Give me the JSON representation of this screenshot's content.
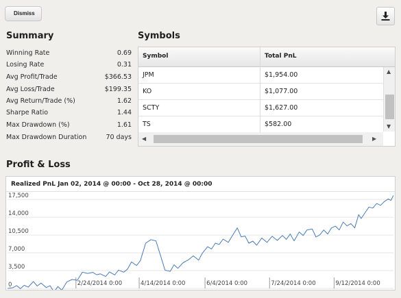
{
  "toolbar": {
    "dismiss_label": "Dismiss",
    "download_icon": "download-icon"
  },
  "summary": {
    "title": "Summary",
    "rows": [
      {
        "label": "Winning Rate",
        "value": "0.69"
      },
      {
        "label": "Losing Rate",
        "value": "0.31"
      },
      {
        "label": "Avg Profit/Trade",
        "value": "$366.53"
      },
      {
        "label": "Avg Loss/Trade",
        "value": "$199.35"
      },
      {
        "label": "Avg Return/Trade (%)",
        "value": "1.62"
      },
      {
        "label": "Sharpe Ratio",
        "value": "1.44"
      },
      {
        "label": "Max Drawdown (%)",
        "value": "1.61"
      },
      {
        "label": "Max Drawdown Duration",
        "value": "70 days"
      }
    ]
  },
  "symbols": {
    "title": "Symbols",
    "columns": [
      "Symbol",
      "Total PnL"
    ],
    "rows": [
      {
        "symbol": "JPM",
        "pnl": "$1,954.00"
      },
      {
        "symbol": "KO",
        "pnl": "$1,077.00"
      },
      {
        "symbol": "SCTY",
        "pnl": "$1,627.00"
      },
      {
        "symbol": "TS",
        "pnl": "$582.00"
      }
    ]
  },
  "pnl": {
    "title": "Profit & Loss",
    "chart_title": "Realized PnL Jan 02, 2014 @ 00:00 - Oct 28, 2014 @ 00:00"
  },
  "chart_data": {
    "type": "line",
    "title": "Realized PnL Jan 02, 2014 @ 00:00 - Oct 28, 2014 @ 00:00",
    "xlabel": "",
    "ylabel": "",
    "ylim": [
      0,
      19000
    ],
    "xlim": [
      "2014-01-02",
      "2014-10-28"
    ],
    "y_ticks": [
      "0",
      "3,500",
      "7,000",
      "10,500",
      "14,000",
      "17,500"
    ],
    "x_ticks": [
      "2/24/2014 0:00",
      "4/14/2014 0:00",
      "6/4/2014 0:00",
      "7/24/2014 0:00",
      "9/12/2014 0:00"
    ],
    "grid": true,
    "series": [
      {
        "color": "#4a7ab8",
        "points": [
          [
            "2014-01-02",
            0
          ],
          [
            "2014-01-06",
            120
          ],
          [
            "2014-01-09",
            550
          ],
          [
            "2014-01-12",
            -40
          ],
          [
            "2014-01-15",
            620
          ],
          [
            "2014-01-18",
            260
          ],
          [
            "2014-01-22",
            1350
          ],
          [
            "2014-01-25",
            480
          ],
          [
            "2014-01-28",
            1050
          ],
          [
            "2014-02-01",
            180
          ],
          [
            "2014-02-04",
            520
          ],
          [
            "2014-02-07",
            -700
          ],
          [
            "2014-02-10",
            380
          ],
          [
            "2014-02-13",
            -350
          ],
          [
            "2014-02-17",
            1300
          ],
          [
            "2014-02-21",
            1750
          ],
          [
            "2014-02-25",
            1600
          ],
          [
            "2014-03-01",
            3200
          ],
          [
            "2014-03-05",
            2950
          ],
          [
            "2014-03-09",
            3150
          ],
          [
            "2014-03-12",
            2700
          ],
          [
            "2014-03-15",
            2850
          ],
          [
            "2014-03-19",
            2350
          ],
          [
            "2014-03-22",
            3250
          ],
          [
            "2014-03-26",
            2650
          ],
          [
            "2014-03-29",
            3600
          ],
          [
            "2014-04-02",
            3200
          ],
          [
            "2014-04-05",
            3800
          ],
          [
            "2014-04-08",
            5200
          ],
          [
            "2014-04-12",
            4500
          ],
          [
            "2014-04-15",
            5500
          ],
          [
            "2014-04-19",
            8900
          ],
          [
            "2014-04-23",
            9600
          ],
          [
            "2014-04-27",
            9350
          ],
          [
            "2014-04-30",
            6900
          ],
          [
            "2014-05-04",
            3600
          ],
          [
            "2014-05-08",
            3350
          ],
          [
            "2014-05-11",
            4650
          ],
          [
            "2014-05-14",
            3950
          ],
          [
            "2014-05-18",
            5050
          ],
          [
            "2014-05-22",
            5600
          ],
          [
            "2014-05-26",
            6400
          ],
          [
            "2014-05-30",
            5550
          ],
          [
            "2014-06-02",
            6950
          ],
          [
            "2014-06-06",
            8200
          ],
          [
            "2014-06-09",
            7750
          ],
          [
            "2014-06-12",
            8900
          ],
          [
            "2014-06-15",
            8650
          ],
          [
            "2014-06-18",
            9700
          ],
          [
            "2014-06-22",
            9050
          ],
          [
            "2014-06-26",
            10700
          ],
          [
            "2014-06-29",
            11900
          ],
          [
            "2014-07-02",
            10150
          ],
          [
            "2014-07-05",
            10300
          ],
          [
            "2014-07-08",
            8900
          ],
          [
            "2014-07-11",
            9300
          ],
          [
            "2014-07-14",
            8500
          ],
          [
            "2014-07-18",
            9900
          ],
          [
            "2014-07-22",
            9050
          ],
          [
            "2014-07-26",
            10250
          ],
          [
            "2014-07-30",
            9450
          ],
          [
            "2014-08-03",
            10400
          ],
          [
            "2014-08-06",
            9650
          ],
          [
            "2014-08-09",
            10700
          ],
          [
            "2014-08-12",
            9350
          ],
          [
            "2014-08-16",
            11100
          ],
          [
            "2014-08-19",
            10400
          ],
          [
            "2014-08-22",
            11500
          ],
          [
            "2014-08-26",
            11700
          ],
          [
            "2014-08-29",
            10100
          ],
          [
            "2014-09-01",
            10550
          ],
          [
            "2014-09-04",
            11500
          ],
          [
            "2014-09-07",
            10700
          ],
          [
            "2014-09-10",
            11900
          ],
          [
            "2014-09-13",
            12250
          ],
          [
            "2014-09-16",
            11500
          ],
          [
            "2014-09-19",
            13050
          ],
          [
            "2014-09-22",
            12300
          ],
          [
            "2014-09-25",
            12750
          ],
          [
            "2014-09-28",
            11900
          ],
          [
            "2014-10-01",
            14500
          ],
          [
            "2014-10-03",
            13750
          ],
          [
            "2014-10-06",
            14900
          ],
          [
            "2014-10-09",
            16000
          ],
          [
            "2014-10-12",
            15800
          ],
          [
            "2014-10-15",
            16700
          ],
          [
            "2014-10-18",
            16350
          ],
          [
            "2014-10-21",
            17100
          ],
          [
            "2014-10-24",
            17600
          ],
          [
            "2014-10-26",
            17300
          ],
          [
            "2014-10-28",
            18300
          ]
        ]
      }
    ]
  },
  "colors": {
    "line": "#4a7ab8",
    "background": "#f1efec",
    "panel": "#ffffff",
    "border": "#cfcfcf"
  }
}
